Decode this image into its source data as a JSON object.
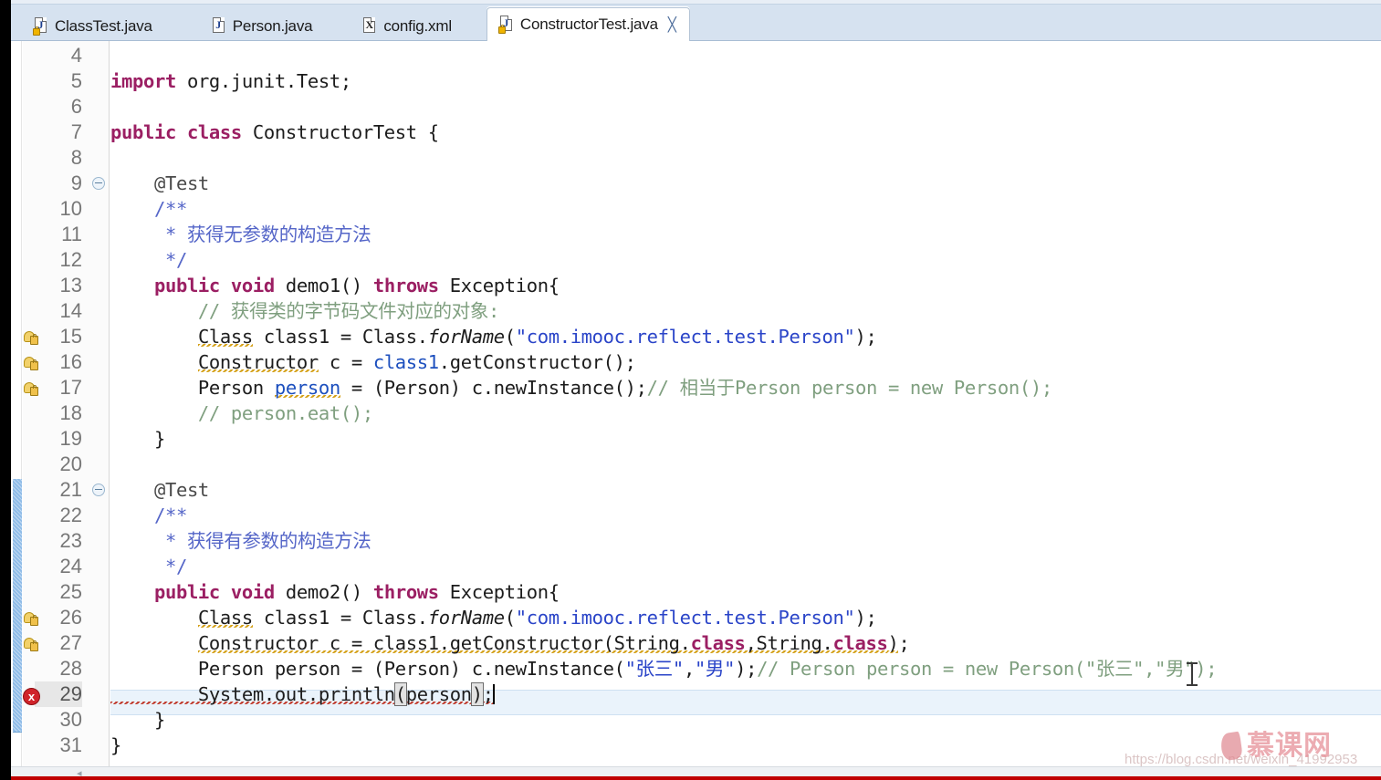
{
  "window": {
    "app": "Eclipse IDE Java Editor"
  },
  "tabs": [
    {
      "label": "ClassTest.java",
      "icon": "java-file-icon",
      "glyph": "J",
      "locked": true,
      "active": false
    },
    {
      "label": "Person.java",
      "icon": "java-file-icon",
      "glyph": "J",
      "locked": false,
      "active": false
    },
    {
      "label": "config.xml",
      "icon": "xml-file-icon",
      "glyph": "X",
      "locked": false,
      "active": false
    },
    {
      "label": "ConstructorTest.java",
      "icon": "java-file-icon",
      "glyph": "J",
      "locked": true,
      "active": true,
      "close": "╳"
    }
  ],
  "editor": {
    "first_line": 4,
    "last_line": 31,
    "current_line": 29,
    "fold_lines": [
      9,
      21
    ],
    "change_bar": {
      "from_line": 21,
      "to_line": 30
    },
    "markers": [
      {
        "line": 15,
        "type": "warning-quickfix-icon"
      },
      {
        "line": 16,
        "type": "warning-quickfix-icon"
      },
      {
        "line": 17,
        "type": "warning-quickfix-icon"
      },
      {
        "line": 26,
        "type": "warning-quickfix-icon"
      },
      {
        "line": 27,
        "type": "warning-quickfix-icon"
      },
      {
        "line": 29,
        "type": "error-icon",
        "glyph": "x"
      }
    ],
    "lines": [
      {
        "n": 4,
        "text": ""
      },
      {
        "n": 5,
        "text": "import org.junit.Test;"
      },
      {
        "n": 6,
        "text": ""
      },
      {
        "n": 7,
        "text": "public class ConstructorTest {"
      },
      {
        "n": 8,
        "text": ""
      },
      {
        "n": 9,
        "text": "    @Test"
      },
      {
        "n": 10,
        "text": "    /**"
      },
      {
        "n": 11,
        "text": "     * 获得无参数的构造方法"
      },
      {
        "n": 12,
        "text": "     */"
      },
      {
        "n": 13,
        "text": "    public void demo1() throws Exception{"
      },
      {
        "n": 14,
        "text": "        // 获得类的字节码文件对应的对象:"
      },
      {
        "n": 15,
        "text": "        Class class1 = Class.forName(\"com.imooc.reflect.test.Person\");"
      },
      {
        "n": 16,
        "text": "        Constructor c = class1.getConstructor();"
      },
      {
        "n": 17,
        "text": "        Person person = (Person) c.newInstance();// 相当于Person person = new Person();"
      },
      {
        "n": 18,
        "text": "        // person.eat();"
      },
      {
        "n": 19,
        "text": "    }"
      },
      {
        "n": 20,
        "text": ""
      },
      {
        "n": 21,
        "text": "    @Test"
      },
      {
        "n": 22,
        "text": "    /**"
      },
      {
        "n": 23,
        "text": "     * 获得有参数的构造方法"
      },
      {
        "n": 24,
        "text": "     */"
      },
      {
        "n": 25,
        "text": "    public void demo2() throws Exception{"
      },
      {
        "n": 26,
        "text": "        Class class1 = Class.forName(\"com.imooc.reflect.test.Person\");"
      },
      {
        "n": 27,
        "text": "        Constructor c = class1.getConstructor(String.class,String.class);"
      },
      {
        "n": 28,
        "text": "        Person person = (Person) c.newInstance(\"张三\",\"男\");// Person person = new Person(\"张三\",\"男\");"
      },
      {
        "n": 29,
        "text": "        System.out.println(person);"
      },
      {
        "n": 30,
        "text": "    }"
      },
      {
        "n": 31,
        "text": "}"
      }
    ]
  },
  "watermarks": {
    "url": "https://blog.csdn.net/weixin_41992953",
    "brand": "慕课网"
  },
  "colors": {
    "keyword": "#9b1f63",
    "string": "#2a44c8",
    "line_comment": "#7f9f7f",
    "javadoc": "#5566c8",
    "field": "#1c4fbe",
    "tabbar_bg": "#d6e2f0",
    "current_line_bg": "#eaf3fb",
    "change_bar": "#8fbce8",
    "error": "#d0232a",
    "warning": "#d4a017"
  }
}
